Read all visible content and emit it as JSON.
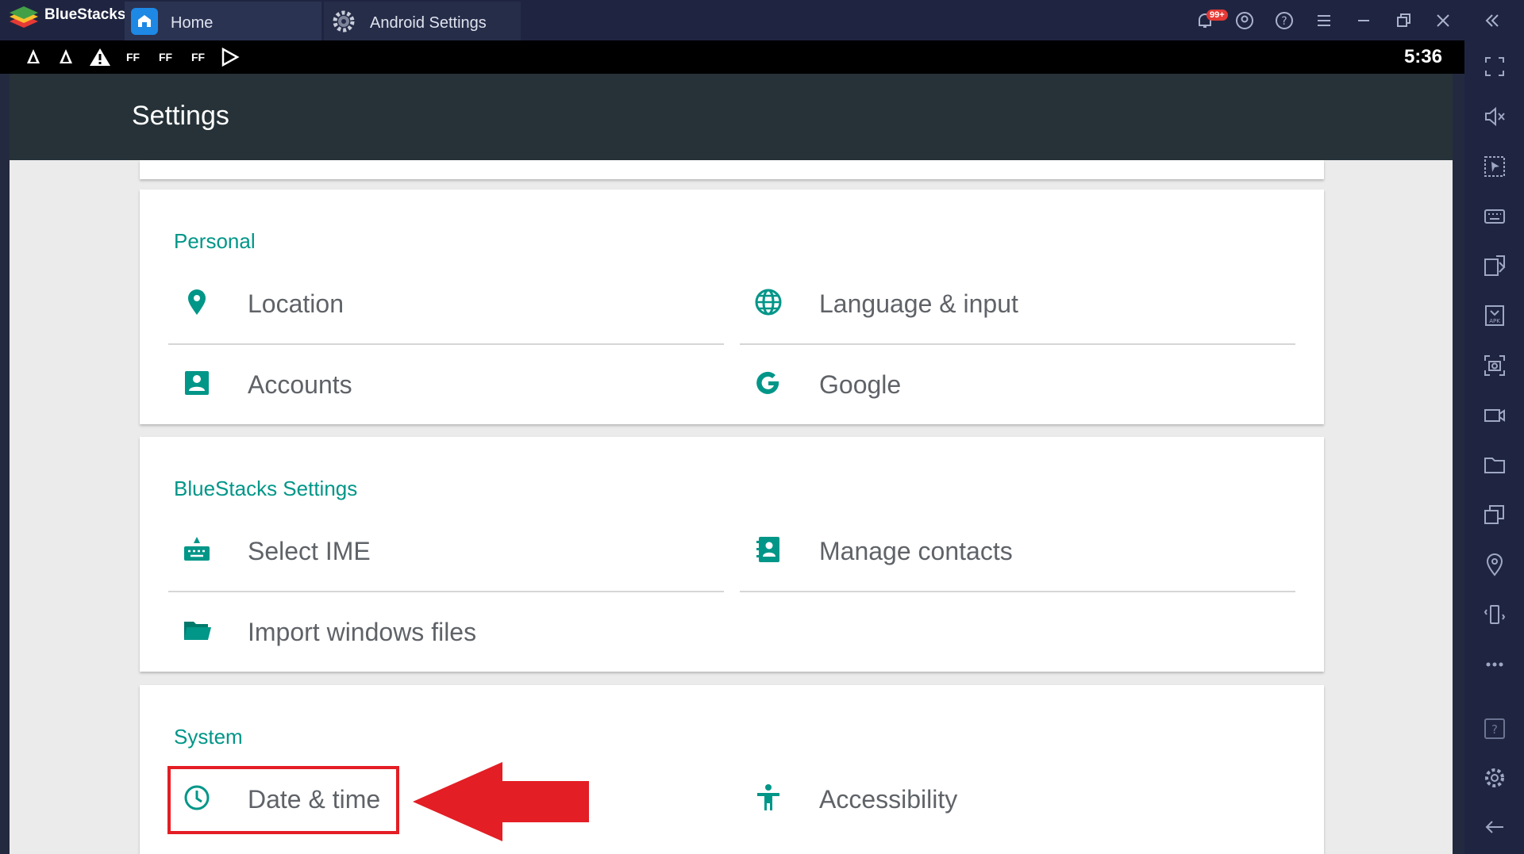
{
  "titlebar": {
    "app_name": "BlueStacks",
    "tabs": [
      {
        "label": "Home",
        "icon": "home-icon"
      },
      {
        "label": "Android Settings",
        "icon": "gear-icon"
      }
    ],
    "notification_badge": "99+",
    "controls": [
      "bell-icon",
      "account-icon",
      "help-icon",
      "menu-icon",
      "minimize-icon",
      "restore-icon",
      "close-icon",
      "collapse-icon"
    ]
  },
  "statusbar": {
    "icons": [
      "app-icon",
      "app-icon",
      "warning-icon",
      "ff-icon",
      "ff-icon",
      "ff-icon",
      "play-store-icon"
    ],
    "ff_label": "FF",
    "time": "5:36"
  },
  "actionbar": {
    "title": "Settings"
  },
  "sections": {
    "personal": {
      "title": "Personal",
      "items": [
        {
          "label": "Location",
          "icon": "location-pin-icon"
        },
        {
          "label": "Language & input",
          "icon": "globe-icon"
        },
        {
          "label": "Accounts",
          "icon": "account-box-icon"
        },
        {
          "label": "Google",
          "icon": "google-g-icon"
        }
      ]
    },
    "bluestacks": {
      "title": "BlueStacks Settings",
      "items": [
        {
          "label": "Select IME",
          "icon": "keyboard-icon"
        },
        {
          "label": "Manage contacts",
          "icon": "contacts-icon"
        },
        {
          "label": "Import windows files",
          "icon": "folder-icon"
        }
      ]
    },
    "system": {
      "title": "System",
      "items": [
        {
          "label": "Date & time",
          "icon": "clock-icon"
        },
        {
          "label": "Accessibility",
          "icon": "accessibility-icon"
        }
      ]
    }
  },
  "sidebar_icons": [
    "fullscreen-icon",
    "mute-icon",
    "select-icon",
    "keyboard-icon",
    "install-apk-icon",
    "apk-icon",
    "screenshot-icon",
    "record-icon",
    "folder-icon",
    "multi-instance-icon",
    "location-icon",
    "shake-icon",
    "more-icon",
    "help-icon",
    "settings-icon",
    "back-icon"
  ],
  "colors": {
    "accent": "#009688",
    "titlebar": "#1f2540",
    "actionbar": "#263238",
    "highlight": "#e31e24"
  }
}
